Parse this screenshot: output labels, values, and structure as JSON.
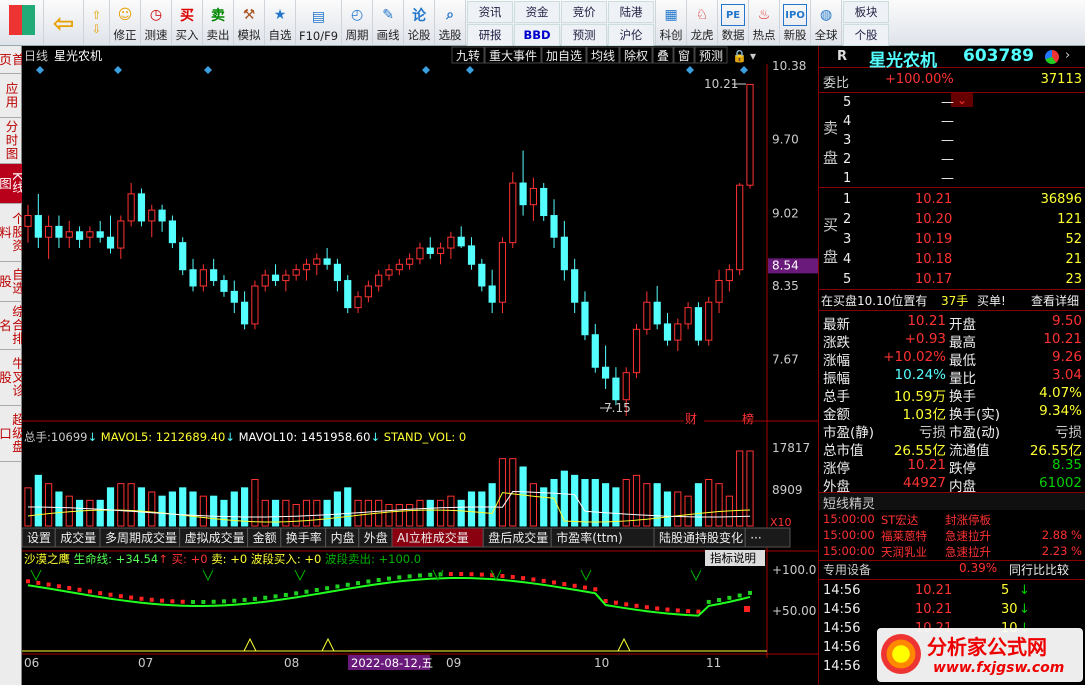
{
  "toolbar": {
    "a": [
      "修正",
      "测速"
    ],
    "b": [
      "买入",
      "卖出",
      "模拟"
    ],
    "c": [
      "自选",
      "F10/F9",
      "周期",
      "画线",
      "论股",
      "选股"
    ],
    "d": [
      "资讯",
      "资金",
      "竞价",
      "陆港",
      "研报",
      "BBD",
      "预测",
      "沪伦"
    ],
    "e": [
      "科创",
      "龙虎",
      "数据",
      "热点",
      "新股"
    ],
    "f": [
      "全球",
      "板块",
      "个股"
    ]
  },
  "left_tabs": [
    "首页",
    "应用",
    "分时图",
    "K线图",
    "个股资料",
    "自选股",
    "综合排名",
    "牛叉诊股",
    "超级盘口"
  ],
  "chart": {
    "period": "日线",
    "name": "星光农机",
    "buttons": [
      "九转",
      "重大事件",
      "加自选",
      "均线",
      "除权",
      "叠",
      "窗",
      "预测"
    ],
    "axis": [
      "10.38",
      "9.70",
      "9.02",
      "8.54",
      "8.35",
      "7.67"
    ],
    "hi": "10.21",
    "lo": "7.15",
    "flag_cai": "财",
    "flag_bang": "榜",
    "vol": {
      "lead": "总手:",
      "v": "10699",
      "ma5": "MAVOL5: 1212689.40",
      "ma10": "MAVOL10: 1451958.60",
      "sv": "STAND_VOL: 0",
      "axis": [
        "17817",
        "8909",
        "X10"
      ]
    },
    "tabs": [
      "设置",
      "成交量",
      "多周期成交量",
      "虚拟成交量",
      "金额",
      "换手率",
      "内盘",
      "外盘",
      "AI立桩成交量",
      "盘后成交量",
      "市盈率(ttm)",
      "陆股通持股变化",
      "···"
    ],
    "ind": {
      "name": "沙漠之鹰",
      "sm": "生命线: +34.54",
      "mr": "买: +0",
      "mc": "卖: +0",
      "bd": "波段买入: +0",
      "bs": "波段卖出: +100.0",
      "help": "指标说明",
      "axis": [
        "+100.0",
        "+50.00"
      ]
    },
    "xaxis": [
      "06",
      "07",
      "08",
      "09",
      "10",
      "11"
    ],
    "date_tag": "2022-08-12,五"
  },
  "chart_data": {
    "type": "candlestick",
    "price_range": [
      7.15,
      10.38
    ],
    "ohlc": [
      [
        8.9,
        9.1,
        8.75,
        9.0
      ],
      [
        9.0,
        9.2,
        8.7,
        8.8
      ],
      [
        8.8,
        9.0,
        8.6,
        8.9
      ],
      [
        8.9,
        9.0,
        8.7,
        8.8
      ],
      [
        8.8,
        8.95,
        8.7,
        8.85
      ],
      [
        8.85,
        8.9,
        8.7,
        8.78
      ],
      [
        8.8,
        8.9,
        8.7,
        8.85
      ],
      [
        8.85,
        8.95,
        8.75,
        8.8
      ],
      [
        8.8,
        9.0,
        8.65,
        8.7
      ],
      [
        8.7,
        9.0,
        8.6,
        8.95
      ],
      [
        8.95,
        9.3,
        8.9,
        9.2
      ],
      [
        9.2,
        9.25,
        8.9,
        8.95
      ],
      [
        8.95,
        9.1,
        8.8,
        9.05
      ],
      [
        9.05,
        9.1,
        8.85,
        8.95
      ],
      [
        8.95,
        9.0,
        8.7,
        8.75
      ],
      [
        8.75,
        8.8,
        8.45,
        8.5
      ],
      [
        8.5,
        8.6,
        8.3,
        8.35
      ],
      [
        8.35,
        8.55,
        8.3,
        8.5
      ],
      [
        8.5,
        8.6,
        8.35,
        8.4
      ],
      [
        8.4,
        8.45,
        8.25,
        8.3
      ],
      [
        8.3,
        8.4,
        8.1,
        8.2
      ],
      [
        8.2,
        8.3,
        7.95,
        8.0
      ],
      [
        8.0,
        8.4,
        7.95,
        8.35
      ],
      [
        8.35,
        8.5,
        8.3,
        8.45
      ],
      [
        8.45,
        8.55,
        8.35,
        8.4
      ],
      [
        8.4,
        8.5,
        8.3,
        8.45
      ],
      [
        8.45,
        8.55,
        8.4,
        8.5
      ],
      [
        8.5,
        8.6,
        8.4,
        8.55
      ],
      [
        8.55,
        8.65,
        8.45,
        8.6
      ],
      [
        8.6,
        8.7,
        8.5,
        8.55
      ],
      [
        8.55,
        8.6,
        8.3,
        8.4
      ],
      [
        8.4,
        8.45,
        8.1,
        8.15
      ],
      [
        8.15,
        8.3,
        8.1,
        8.25
      ],
      [
        8.25,
        8.4,
        8.2,
        8.35
      ],
      [
        8.35,
        8.5,
        8.3,
        8.45
      ],
      [
        8.45,
        8.55,
        8.4,
        8.5
      ],
      [
        8.5,
        8.6,
        8.45,
        8.55
      ],
      [
        8.55,
        8.65,
        8.5,
        8.6
      ],
      [
        8.6,
        8.75,
        8.55,
        8.7
      ],
      [
        8.7,
        8.8,
        8.6,
        8.65
      ],
      [
        8.65,
        8.75,
        8.55,
        8.7
      ],
      [
        8.7,
        8.85,
        8.6,
        8.8
      ],
      [
        8.8,
        8.9,
        8.7,
        8.72
      ],
      [
        8.72,
        8.8,
        8.5,
        8.55
      ],
      [
        8.55,
        8.6,
        8.3,
        8.35
      ],
      [
        8.35,
        8.5,
        8.1,
        8.2
      ],
      [
        8.2,
        8.8,
        8.1,
        8.75
      ],
      [
        8.75,
        9.4,
        8.7,
        9.3
      ],
      [
        9.3,
        9.6,
        9.0,
        9.1
      ],
      [
        9.1,
        9.35,
        8.95,
        9.25
      ],
      [
        9.25,
        9.3,
        8.95,
        9.0
      ],
      [
        9.0,
        9.15,
        8.7,
        8.8
      ],
      [
        8.8,
        8.95,
        8.4,
        8.5
      ],
      [
        8.5,
        8.6,
        8.1,
        8.2
      ],
      [
        8.2,
        8.3,
        7.85,
        7.9
      ],
      [
        7.9,
        8.0,
        7.55,
        7.6
      ],
      [
        7.6,
        7.8,
        7.4,
        7.5
      ],
      [
        7.5,
        7.6,
        7.25,
        7.3
      ],
      [
        7.3,
        7.6,
        7.15,
        7.55
      ],
      [
        7.55,
        8.0,
        7.5,
        7.95
      ],
      [
        7.95,
        8.3,
        7.9,
        8.2
      ],
      [
        8.2,
        8.35,
        7.95,
        8.0
      ],
      [
        8.0,
        8.1,
        7.8,
        7.85
      ],
      [
        7.85,
        8.05,
        7.75,
        8.0
      ],
      [
        8.0,
        8.2,
        7.95,
        8.15
      ],
      [
        8.15,
        8.2,
        7.8,
        7.85
      ],
      [
        7.85,
        8.25,
        7.8,
        8.2
      ],
      [
        8.2,
        8.5,
        8.1,
        8.4
      ],
      [
        8.4,
        8.55,
        8.3,
        8.5
      ],
      [
        8.5,
        9.3,
        8.45,
        9.28
      ],
      [
        9.28,
        10.21,
        9.25,
        10.21
      ]
    ]
  },
  "quote": {
    "name": "星光农机",
    "code": "603789",
    "mark": "R",
    "wb_l": "委比",
    "wb": "+100.00%",
    "wc": "37113",
    "sell_l": [
      "卖",
      "盘"
    ],
    "buy_l": [
      "买",
      "盘"
    ],
    "sells": [
      {
        "n": "5",
        "p": "",
        "v": "—"
      },
      {
        "n": "4",
        "p": "",
        "v": "—"
      },
      {
        "n": "3",
        "p": "",
        "v": "—"
      },
      {
        "n": "2",
        "p": "",
        "v": "—"
      },
      {
        "n": "1",
        "p": "",
        "v": "—"
      }
    ],
    "buys": [
      {
        "n": "1",
        "p": "10.21",
        "v": "36896"
      },
      {
        "n": "2",
        "p": "10.20",
        "v": "121"
      },
      {
        "n": "3",
        "p": "10.19",
        "v": "52"
      },
      {
        "n": "4",
        "p": "10.18",
        "v": "21"
      },
      {
        "n": "5",
        "p": "10.17",
        "v": "23"
      }
    ],
    "notice": "在买盘10.10位置有",
    "nv": "37手",
    "ntag": "买单!",
    "detail": "查看详细",
    "stats": [
      [
        "最新",
        "10.21",
        "开盘",
        "9.50"
      ],
      [
        "涨跌",
        "+0.93",
        "最高",
        "10.21"
      ],
      [
        "涨幅",
        "+10.02%",
        "最低",
        "9.26"
      ],
      [
        "振幅",
        "10.24%",
        "量比",
        "3.04"
      ],
      [
        "总手",
        "10.59万",
        "换手",
        "4.07%"
      ],
      [
        "金额",
        "1.03亿",
        "换手(实)",
        "9.34%"
      ],
      [
        "市盈(静)",
        "亏损",
        "市盈(动)",
        "亏损"
      ],
      [
        "总市值",
        "26.55亿",
        "流通值",
        "26.55亿"
      ],
      [
        "涨停",
        "10.21",
        "跌停",
        "8.35"
      ],
      [
        "外盘",
        "44927",
        "内盘",
        "61002"
      ]
    ],
    "sprite": {
      "title": "短线精灵",
      "rows": [
        [
          "15:00:00",
          "ST宏达",
          "封涨停板",
          ""
        ],
        [
          "15:00:00",
          "福莱蒽特",
          "急速拉升",
          "2.88 %"
        ],
        [
          "15:00:00",
          "天润乳业",
          "急速拉升",
          "2.23 %"
        ]
      ]
    },
    "dev": "专用设备",
    "dev_pct": "0.39%",
    "dev_cmp": "同行比比较",
    "ticks": [
      [
        "14:56",
        "10.21",
        "5"
      ],
      [
        "14:56",
        "10.21",
        "30"
      ],
      [
        "14:56",
        "10.21",
        "10"
      ],
      [
        "14:56",
        "",
        ""
      ],
      [
        "14:56",
        "",
        ""
      ]
    ]
  },
  "watermark": {
    "cn": "分析家公式网",
    "url": "www.fxjgsw.com"
  }
}
